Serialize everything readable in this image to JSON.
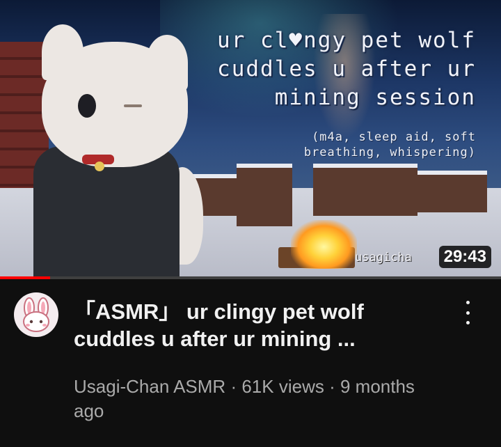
{
  "video": {
    "thumbnail": {
      "overlay_title_lines": [
        "ur cl♥ngy pet wolf",
        "cuddles u after ur",
        "mining session"
      ],
      "overlay_subtitle_lines": [
        "(m4a, sleep aid, soft",
        "breathing, whispering)"
      ],
      "watermark": "usagicha",
      "duration": "29:43",
      "watch_progress": 0.1,
      "accent_color": "#ff0000"
    },
    "title": "「ASMR」 ur clingy pet wolf cuddles u after ur mining ...",
    "channel": "Usagi-Chan ASMR",
    "views": "61K views",
    "separator": "·",
    "age": "9 months ago",
    "icons": {
      "avatar": "bunny-avatar-icon",
      "menu": "more-vert-icon"
    }
  }
}
